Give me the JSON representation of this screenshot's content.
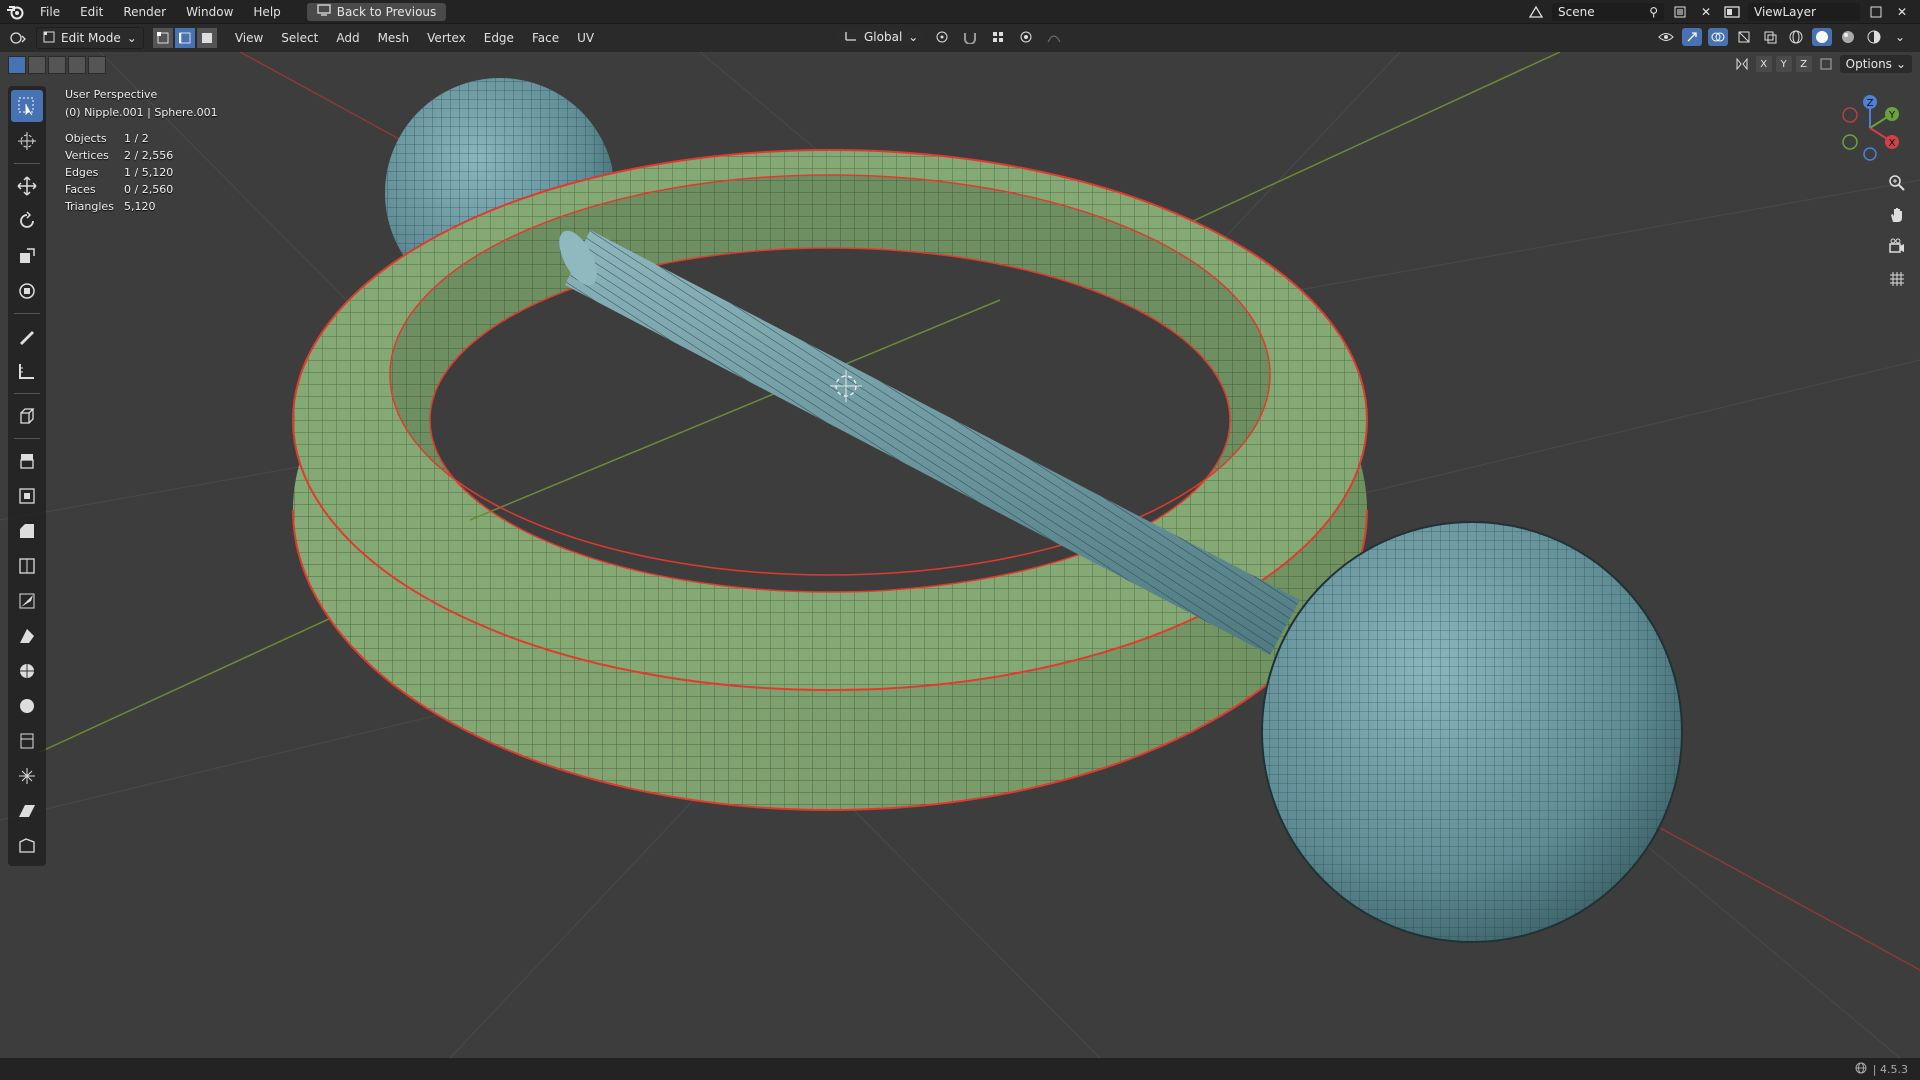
{
  "menubar": {
    "items": [
      "File",
      "Edit",
      "Render",
      "Window",
      "Help"
    ],
    "back_button": "Back to Previous",
    "scene_label": "Scene",
    "viewlayer_label": "ViewLayer"
  },
  "header": {
    "mode": "Edit Mode",
    "menus": [
      "View",
      "Select",
      "Add",
      "Mesh",
      "Vertex",
      "Edge",
      "Face",
      "UV"
    ],
    "transform_orientation": "Global",
    "options_label": "Options",
    "axes": [
      "X",
      "Y",
      "Z"
    ]
  },
  "overlay": {
    "perspective": "User Perspective",
    "object_info": "(0) Nipple.001 | Sphere.001",
    "stats": [
      {
        "label": "Objects",
        "value": "1 / 2"
      },
      {
        "label": "Vertices",
        "value": "2 / 2,556"
      },
      {
        "label": "Edges",
        "value": "1 / 5,120"
      },
      {
        "label": "Faces",
        "value": "0 / 2,560"
      },
      {
        "label": "Triangles",
        "value": "5,120"
      }
    ]
  },
  "gizmo": {
    "x": "X",
    "y": "Y",
    "z": "Z"
  },
  "status": {
    "version": "4.5.3"
  },
  "colors": {
    "ring": "#7fa36f",
    "metal": "#6f9aa3",
    "seam": "#e03a2f",
    "grid_x": "#8a3a3a",
    "grid_y": "#6b8a3a",
    "accent": "#4772b3"
  }
}
